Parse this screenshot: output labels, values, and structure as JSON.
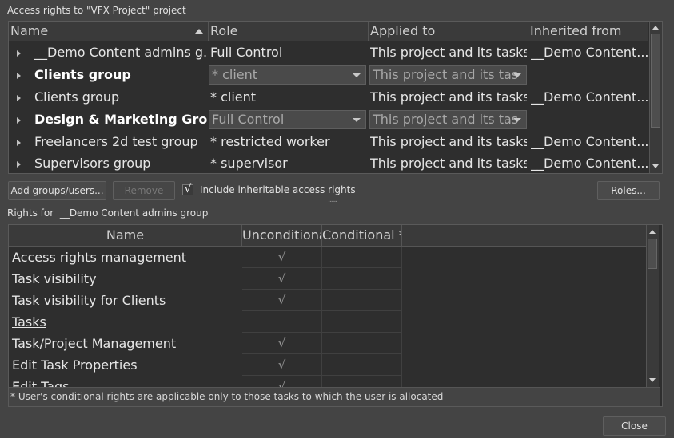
{
  "window": {
    "section_title": "Access rights to \"VFX Project\" project"
  },
  "groups_table": {
    "columns": [
      "Name",
      "Role",
      "Applied to",
      "Inherited from"
    ],
    "rows": [
      {
        "name": "__Demo Content admins g...",
        "role": "Full Control",
        "applied": "This project and its tasks",
        "inherited": "__Demo Content..."
      },
      {
        "name": "Clients group",
        "role": "* client",
        "applied": "This project and its tas"
      },
      {
        "name": "Clients group",
        "role": "* client",
        "applied": "This project and its tasks",
        "inherited": "__Demo Content..."
      },
      {
        "name": "Design & Marketing Grou",
        "role": "Full Control",
        "applied": "This project and its tas"
      },
      {
        "name": "Freelancers 2d test group",
        "role": "* restricted worker",
        "applied": "This project and its tasks",
        "inherited": "__Demo Content..."
      },
      {
        "name": "Supervisors group",
        "role": "* supervisor",
        "applied": "This project and its tasks",
        "inherited": "__Demo Content..."
      }
    ]
  },
  "toolbar": {
    "add_label": "Add groups/users...",
    "remove_label": "Remove",
    "include_label": "Include inheritable access rights",
    "include_checked": "√",
    "roles_label": "Roles...",
    "splitter": "......"
  },
  "rights": {
    "title_prefix": "Rights for",
    "group_name": "__Demo Content admins group",
    "columns": [
      "Name",
      "Unconditional",
      "Conditional *"
    ],
    "rows": [
      {
        "name": "Access rights management",
        "unconditional": "√",
        "conditional": ""
      },
      {
        "name": "Task visibility",
        "unconditional": "√",
        "conditional": ""
      },
      {
        "name": "Task visibility for Clients",
        "unconditional": "√",
        "conditional": ""
      },
      {
        "name": "Tasks",
        "unconditional": "",
        "conditional": ""
      },
      {
        "name": "Task/Project Management",
        "unconditional": "√",
        "conditional": ""
      },
      {
        "name": "Edit Task Properties",
        "unconditional": "√",
        "conditional": ""
      },
      {
        "name": "Edit Tags",
        "unconditional": "√",
        "conditional": ""
      }
    ],
    "footnote": "* User's conditional rights are applicable only to those tasks to which the user is allocated"
  },
  "footer": {
    "close_label": "Close"
  },
  "colors": {
    "background": "#444444",
    "table_bg": "#2e2e2e",
    "header_bg": "#3a3a3a",
    "text": "#e6e6e6"
  }
}
